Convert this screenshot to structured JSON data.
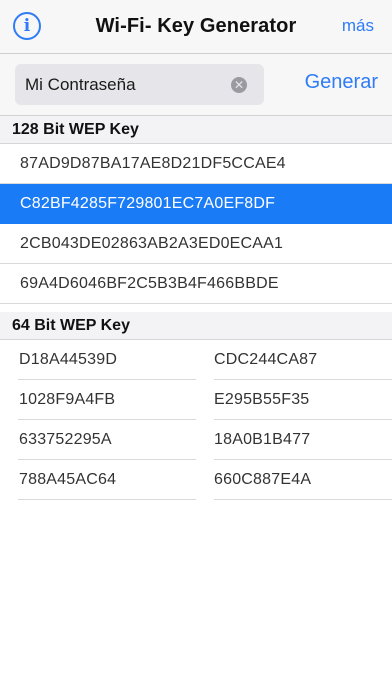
{
  "navbar": {
    "title": "Wi-Fi- Key Generator",
    "info_icon": "info-icon",
    "info_glyph": "i",
    "more_label": "más"
  },
  "search": {
    "value": "Mi Contraseña",
    "clear_icon": "clear-icon",
    "clear_glyph": "✕",
    "generate_label": "Generar"
  },
  "wep128": {
    "header": "128 Bit WEP Key",
    "keys": [
      "87AD9D87BA17AE8D21DF5CCAE4",
      "C82BF4285F729801EC7A0EF8DF",
      "2CB043DE02863AB2A3ED0ECAA1",
      "69A4D6046BF2C5B3B4F466BBDE"
    ],
    "selected_index": 1
  },
  "wep64": {
    "header": "64 Bit WEP Key",
    "rows": [
      [
        "D18A44539D",
        "CDC244CA87"
      ],
      [
        "1028F9A4FB",
        "E295B55F35"
      ],
      [
        "633752295A",
        "18A0B1B477"
      ],
      [
        "788A45AC64",
        "660C887E4A"
      ]
    ]
  },
  "colors": {
    "accent": "#2f7cf6",
    "selection": "#1a7bf6"
  }
}
